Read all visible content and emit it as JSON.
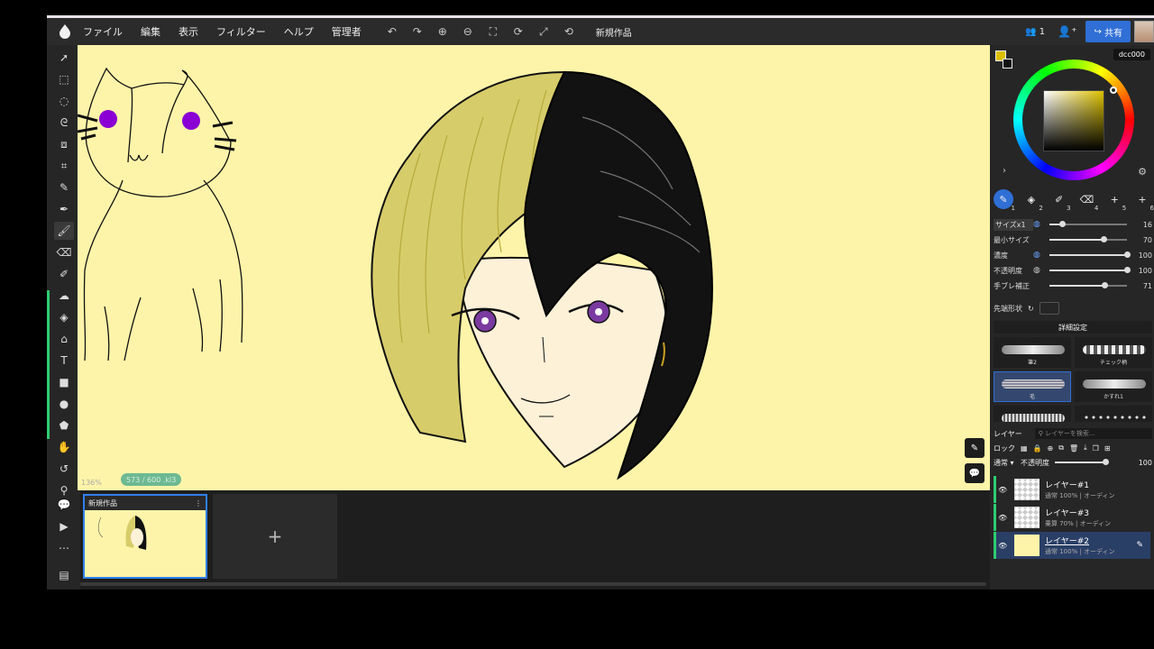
{
  "menu": [
    "ファイル",
    "編集",
    "表示",
    "フィルター",
    "ヘルプ",
    "管理者"
  ],
  "doc_title": "新規作品",
  "users_count": "1",
  "share_label": "共有",
  "color": {
    "hex": "dcc000",
    "foreground": "#dcc000",
    "background": "#111111"
  },
  "brush_slots": [
    "1",
    "2",
    "3",
    "4",
    "5",
    "6"
  ],
  "sliders": [
    {
      "label": "サイズx1",
      "value": "16",
      "fraction": 0.16
    },
    {
      "label": "最小サイズ",
      "value": "70",
      "fraction": 0.7
    },
    {
      "label": "濃度",
      "value": "100",
      "fraction": 1.0
    },
    {
      "label": "不透明度",
      "value": "100",
      "fraction": 1.0
    },
    {
      "label": "手ブレ補正",
      "value": "71",
      "fraction": 0.71
    }
  ],
  "tip_label": "先端形状",
  "detail_label": "詳細設定",
  "brushes": [
    "筆2",
    "チェック柄",
    "毛",
    "かすれ1",
    "",
    ""
  ],
  "zoom": "136%",
  "stroke_count": "573 / 600 .kl3",
  "thumbnail_title": "新規作品",
  "layer_panel": {
    "title": "レイヤー",
    "search_placeholder": "レイヤーを検索…",
    "lock_label": "ロック",
    "blend_mode": "通常",
    "opacity_label": "不透明度",
    "opacity_value": "100"
  },
  "layers": [
    {
      "name": "レイヤー#1",
      "sub": "通常 100% | オーディン",
      "active": false
    },
    {
      "name": "レイヤー#3",
      "sub": "乗算 70% | オーディン",
      "active": false
    },
    {
      "name": "レイヤー#2",
      "sub": "通常 100% | オーディン",
      "active": true
    }
  ]
}
